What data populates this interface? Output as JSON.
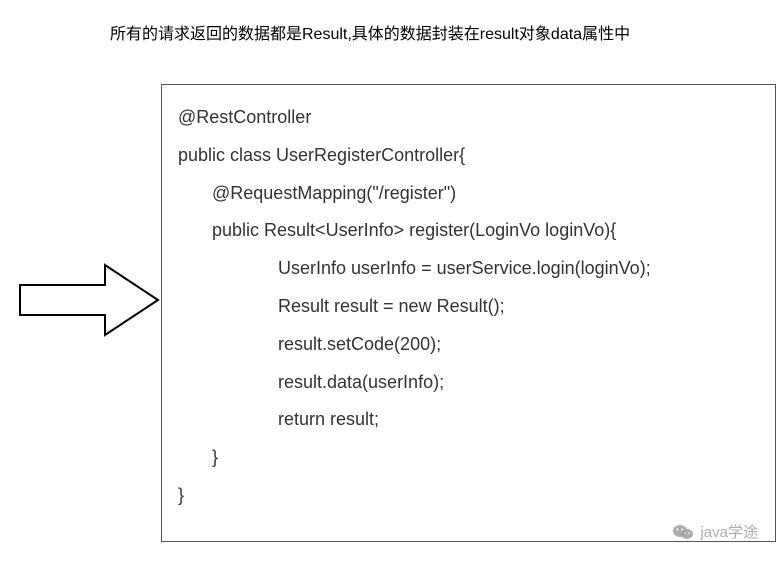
{
  "header": {
    "description": "所有的请求返回的数据都是Result,具体的数据封装在result对象data属性中"
  },
  "code": {
    "lines": [
      {
        "indent": 0,
        "text": "@RestController"
      },
      {
        "indent": 0,
        "text": "public class UserRegisterController{"
      },
      {
        "indent": 1,
        "text": "@RequestMapping(\"/register\")"
      },
      {
        "indent": 1,
        "text": "public Result<UserInfo> register(LoginVo loginVo){"
      },
      {
        "indent": 2,
        "text": "UserInfo userInfo = userService.login(loginVo);"
      },
      {
        "indent": 2,
        "text": "Result result = new Result();"
      },
      {
        "indent": 2,
        "text": "result.setCode(200);"
      },
      {
        "indent": 2,
        "text": "result.data(userInfo);"
      },
      {
        "indent": 2,
        "text": "return result;"
      },
      {
        "indent": 1,
        "text": "}"
      },
      {
        "indent": 0,
        "text": "}"
      }
    ]
  },
  "watermark": {
    "icon_name": "wechat-icon",
    "text": "java学途"
  }
}
